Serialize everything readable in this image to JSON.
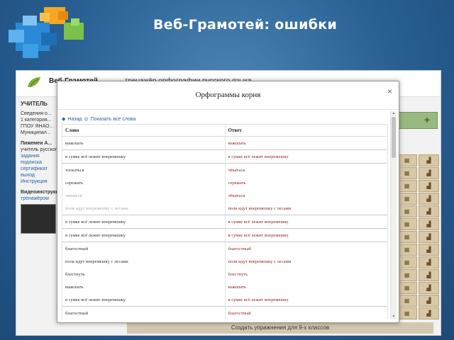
{
  "slide": {
    "title": "Веб-Грамотей: ошибки"
  },
  "app": {
    "title": "Веб-Грамотей",
    "subtitle": "— тренажёр орфографии русского языка",
    "teacher_label": "УЧИТЕЛЬ",
    "info_lines": [
      "Сведения о...",
      "1 категория...",
      "ГПОУ ЯНАО...",
      "Муниципал..."
    ],
    "section1": "Пижемеи А...",
    "section1_note": "учитель русского...",
    "links": [
      "задания",
      "подписка",
      "сертификат",
      "выход"
    ],
    "section2": "Инструкция",
    "section3": "Видеоинструкция",
    "section3_link": "тренажёром",
    "footer_link": "Создать упражнения для 9-х классов",
    "add_btn": "+"
  },
  "modal": {
    "title": "Орфограммы корня",
    "close": "×",
    "nav_back": "Назад",
    "nav_show_all": "Показать все слова",
    "columns": [
      "Слово",
      "Ответ"
    ],
    "rows": [
      {
        "word": "выкопать",
        "answer": "выкопать"
      },
      {
        "word": "в сумке всё лежит вперемешку",
        "answer": "в сумке всё лежит вперемешку"
      },
      {
        "word": "тоскаться",
        "answer": "чёкаться"
      },
      {
        "word": "сережать",
        "answer": "сережать"
      },
      {
        "word": "чекаться",
        "answer": "чёкаться"
      },
      {
        "word": "поля идут вперемешку с лесами",
        "answer": "поля идут вперемешку с лесами"
      },
      {
        "word": "в сумке всё лежит вперемешку",
        "answer": "в сумке всё лежит вперемешку"
      },
      {
        "word": "в сумке всё лежит вперемешку",
        "answer": "в сумке всё лежит вперемешку"
      },
      {
        "word": "благостный",
        "answer": "благостный"
      },
      {
        "word": "поля идут вперемешку с лесами",
        "answer": "поля идут вперемешку с лесами"
      },
      {
        "word": "блестнуть",
        "answer": "блестнуть"
      },
      {
        "word": "выкопать",
        "answer": "выкопать"
      },
      {
        "word": "в сумке всё лежит вперемешку",
        "answer": "в сумке всё лежит вперемешку"
      },
      {
        "word": "благостный",
        "answer": "благостный"
      }
    ]
  },
  "icons": {
    "cell_a": "grid-icon",
    "cell_b": "chart-icon",
    "cell_a_glyph": "▦",
    "cell_b_glyph": "▟"
  }
}
